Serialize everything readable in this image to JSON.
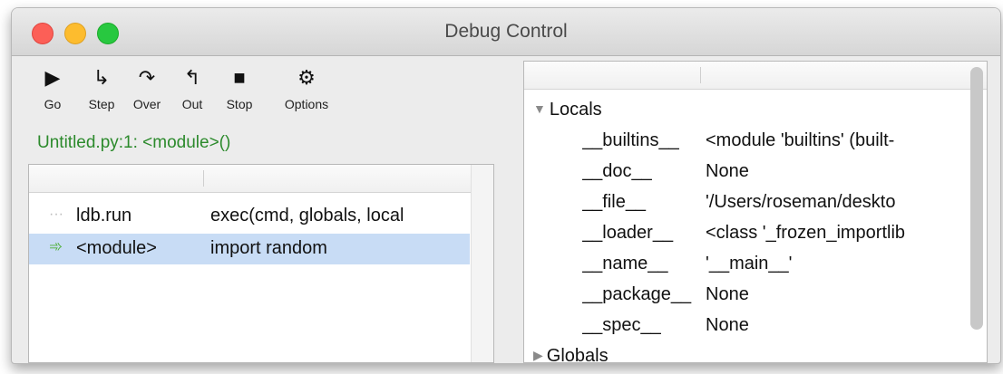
{
  "window": {
    "title": "Debug Control"
  },
  "toolbar": {
    "buttons": [
      {
        "label": "Go",
        "icon": "play-icon",
        "glyph": "▶"
      },
      {
        "label": "Step",
        "icon": "step-icon",
        "glyph": "↳"
      },
      {
        "label": "Over",
        "icon": "step-over-icon",
        "glyph": "↷"
      },
      {
        "label": "Out",
        "icon": "step-out-icon",
        "glyph": "↰"
      },
      {
        "label": "Stop",
        "icon": "stop-icon",
        "glyph": "■"
      },
      {
        "label": "Options",
        "icon": "gear-icon",
        "glyph": "⚙"
      }
    ]
  },
  "location": "Untitled.py:1: <module>()",
  "stack": {
    "rows": [
      {
        "marker": "···",
        "function": "ldb.run",
        "code": "exec(cmd, globals, local"
      },
      {
        "marker": "➾",
        "function": "<module>",
        "code": "import random"
      }
    ]
  },
  "variables": {
    "locals_label": "Locals",
    "globals_label": "Globals",
    "rows": [
      {
        "name": "__builtins__",
        "value": "<module 'builtins' (built-"
      },
      {
        "name": "__doc__",
        "value": "None"
      },
      {
        "name": "__file__",
        "value": "'/Users/roseman/deskto"
      },
      {
        "name": "__loader__",
        "value": "<class '_frozen_importlib"
      },
      {
        "name": "__name__",
        "value": "'__main__'"
      },
      {
        "name": "__package__",
        "value": "None"
      },
      {
        "name": "__spec__",
        "value": "None"
      }
    ]
  }
}
